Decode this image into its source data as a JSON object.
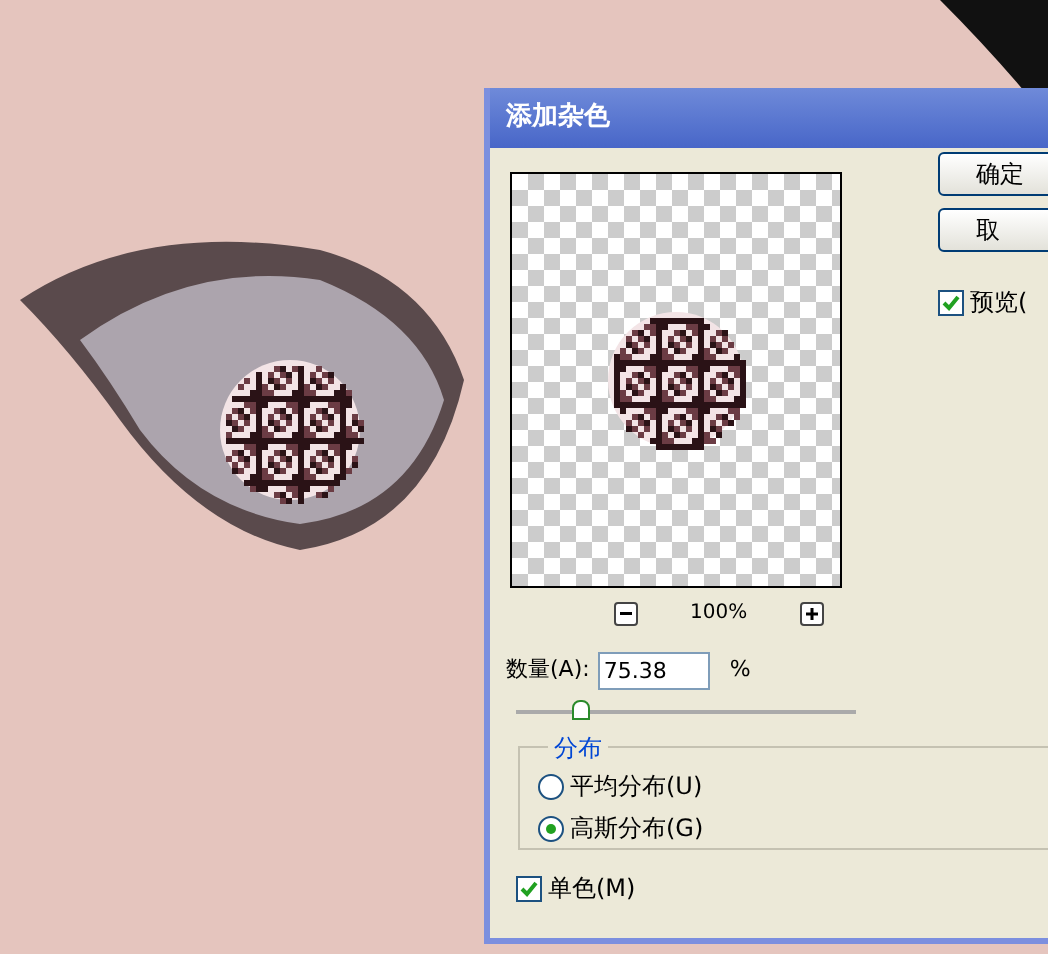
{
  "window": {
    "title": "添加杂色"
  },
  "buttons": [
    {
      "label": "确定"
    },
    {
      "label": "取"
    }
  ],
  "preview_toggle": {
    "label": "预览(",
    "checked": true
  },
  "zoom": {
    "value": "100%"
  },
  "amount": {
    "label": "数量(A):",
    "value": "75.38",
    "unit": "%",
    "level": 0.19
  },
  "distribution": {
    "title": "分布",
    "options": [
      {
        "label": "平均分布(U)",
        "selected": false
      },
      {
        "label": "高斯分布(G)",
        "selected": true
      }
    ]
  },
  "monochromatic": {
    "label": "单色(M)",
    "checked": true
  }
}
